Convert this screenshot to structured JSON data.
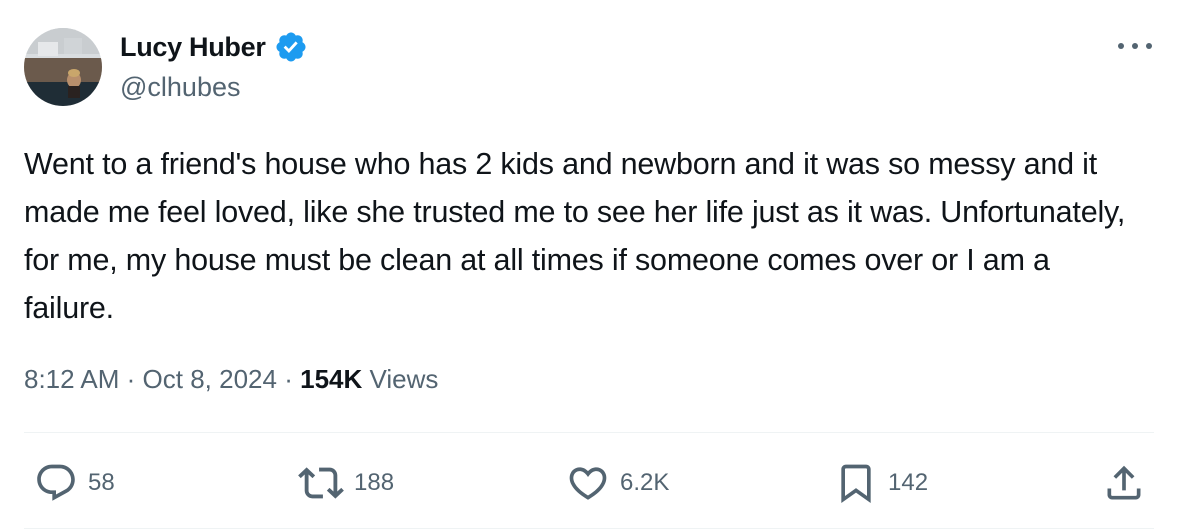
{
  "author": {
    "display_name": "Lucy Huber",
    "handle": "@clhubes",
    "verified": true,
    "verified_color": "#1d9bf0",
    "avatar": "profile-photo"
  },
  "tweet": {
    "text": "Went to a friend's house who has 2 kids and newborn and it was so messy and it made me feel loved, like she trusted me to see her life just as it was. Unfortunately, for me, my house must be clean at all times if someone comes over or I am a failure."
  },
  "meta": {
    "time": "8:12 AM",
    "separator": "·",
    "date": "Oct 8, 2024",
    "views_count": "154K",
    "views_label": "Views"
  },
  "actions": {
    "reply": {
      "icon": "reply-icon",
      "count": "58"
    },
    "retweet": {
      "icon": "retweet-icon",
      "count": "188"
    },
    "like": {
      "icon": "heart-icon",
      "count": "6.2K"
    },
    "bookmark": {
      "icon": "bookmark-icon",
      "count": "142"
    },
    "share": {
      "icon": "share-icon"
    }
  },
  "more_menu": {
    "icon": "more-options-icon"
  }
}
